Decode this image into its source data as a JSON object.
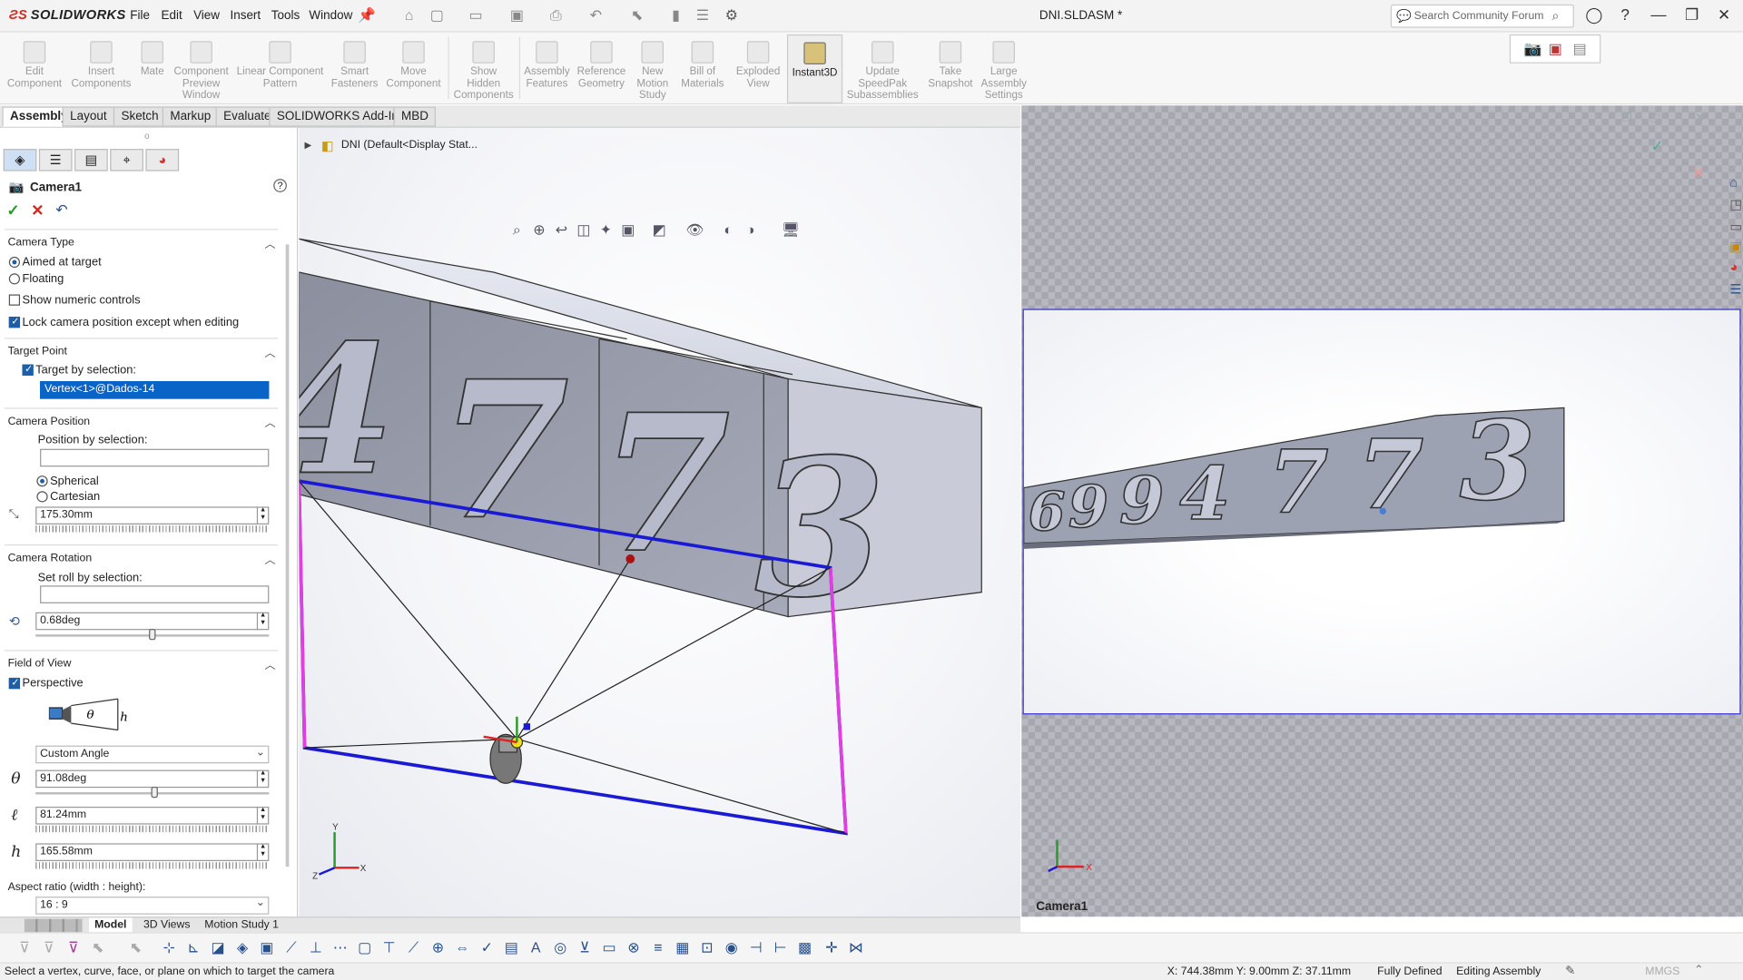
{
  "app": {
    "name": "SOLIDWORKS",
    "doc_title": "DNI.SLDASM *"
  },
  "menu": [
    "File",
    "Edit",
    "View",
    "Insert",
    "Tools",
    "Window"
  ],
  "search": {
    "placeholder": "Search Community Forum"
  },
  "commands": [
    {
      "label": "Edit\nComponent",
      "enabled": false
    },
    {
      "label": "Insert\nComponents",
      "enabled": false
    },
    {
      "label": "Mate",
      "enabled": false
    },
    {
      "label": "Component\nPreview\nWindow",
      "enabled": false
    },
    {
      "label": "Linear Component\nPattern",
      "enabled": false
    },
    {
      "label": "Smart\nFasteners",
      "enabled": false
    },
    {
      "label": "Move\nComponent",
      "enabled": false
    },
    {
      "label": "Show\nHidden\nComponents",
      "enabled": false
    },
    {
      "label": "Assembly\nFeatures",
      "enabled": false
    },
    {
      "label": "Reference\nGeometry",
      "enabled": false
    },
    {
      "label": "New\nMotion\nStudy",
      "enabled": false
    },
    {
      "label": "Bill of\nMaterials",
      "enabled": false
    },
    {
      "label": "Exploded\nView",
      "enabled": false
    },
    {
      "label": "Instant3D",
      "enabled": true
    },
    {
      "label": "Update\nSpeedPak\nSubassemblies",
      "enabled": false
    },
    {
      "label": "Take\nSnapshot",
      "enabled": false
    },
    {
      "label": "Large\nAssembly\nSettings",
      "enabled": false
    }
  ],
  "tabs": [
    "Assembly",
    "Layout",
    "Sketch",
    "Markup",
    "Evaluate",
    "SOLIDWORKS Add-Ins",
    "MBD"
  ],
  "active_tab": "Assembly",
  "tree": {
    "root_label": "DNI  (Default<Display Stat..."
  },
  "property_manager": {
    "title": "Camera1",
    "camera_type": {
      "header": "Camera Type",
      "aimed": "Aimed at target",
      "floating": "Floating",
      "show_numeric": "Show numeric controls",
      "lock_position": "Lock camera position except when editing"
    },
    "target_point": {
      "header": "Target Point",
      "by_selection": "Target by selection:",
      "value": "Vertex<1>@Dados-14"
    },
    "camera_position": {
      "header": "Camera Position",
      "by_selection": "Position by selection:",
      "value": "",
      "spherical": "Spherical",
      "cartesian": "Cartesian",
      "distance": "175.30mm"
    },
    "camera_rotation": {
      "header": "Camera Rotation",
      "set_roll": "Set roll by selection:",
      "value": "",
      "roll": "0.68deg"
    },
    "field_of_view": {
      "header": "Field of View",
      "perspective": "Perspective",
      "mode": "Custom Angle",
      "theta": "91.08deg",
      "ell": "81.24mm",
      "h": "165.58mm",
      "aspect_label": "Aspect ratio (width : height):",
      "aspect": "16 : 9"
    }
  },
  "model": {
    "digits_main": [
      "4",
      "7",
      "7",
      "3"
    ],
    "digits_preview": [
      "6",
      "9",
      "9",
      "4",
      "7",
      "7",
      "3"
    ]
  },
  "camera_view_label": "Camera1",
  "bottom_tabs": [
    "Model",
    "3D Views",
    "Motion Study 1"
  ],
  "status": {
    "message": "Select a vertex, curve, face, or plane on which to target the camera",
    "coords": "X: 744.38mm Y: 9.00mm Z: 37.11mm",
    "state": "Fully Defined",
    "mode": "Editing Assembly",
    "units": "MMGS"
  },
  "colors": {
    "accent": "#1d5ea8",
    "selection": "#0a64c8",
    "frustum_blue": "#1a1ad6",
    "frustum_magenta": "#e040e0"
  }
}
